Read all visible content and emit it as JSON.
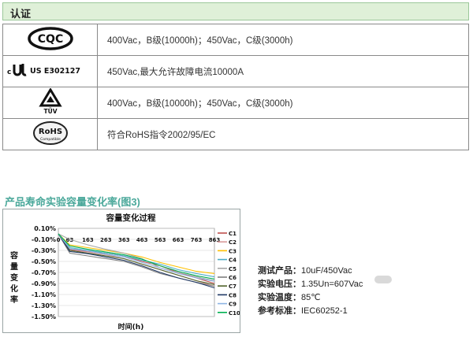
{
  "header": {
    "title": "认证"
  },
  "certifications": [
    {
      "logo": "CQC",
      "logo_icon": "cqc-logo-icon",
      "text": "400Vac，B级(10000h)；450Vac，C级(3000h)"
    },
    {
      "logo": "US E302127",
      "logo_prefix": "c",
      "logo_icon": "ul-logo-icon",
      "text": "450Vac,最大允许故障电流10000A"
    },
    {
      "logo": "TÜV",
      "logo_icon": "tuv-logo-icon",
      "text": "400Vac，B级(10000h)；450Vac，C级(3000h)"
    },
    {
      "logo": "RoHS",
      "logo_sub": "Compatible",
      "logo_icon": "rohs-logo-icon",
      "text": "符合RoHS指令2002/95/EC"
    }
  ],
  "section_title": "产品寿命实验容量变化率(图3)",
  "chart_data": {
    "type": "line",
    "title": "容量变化过程",
    "xlabel": "时间(h)",
    "ylabel": "容量变化率",
    "x": [
      0,
      63,
      163,
      263,
      363,
      463,
      563,
      663,
      763,
      863
    ],
    "x_ticks": [
      "0",
      "63",
      "163",
      "263",
      "363",
      "463",
      "563",
      "663",
      "763",
      "863"
    ],
    "y_ticks": [
      "0.10%",
      "-0.10%",
      "-0.30%",
      "-0.50%",
      "-0.70%",
      "-0.90%",
      "-1.10%",
      "-1.30%",
      "-1.50%"
    ],
    "ylim": [
      -1.5,
      0.1
    ],
    "grid": true,
    "legend": "right",
    "series": [
      {
        "name": "C1",
        "color": "#c0504d",
        "values": [
          0.0,
          -0.28,
          -0.32,
          -0.35,
          -0.4,
          -0.5,
          -0.58,
          -0.7,
          -0.8,
          -0.9
        ]
      },
      {
        "name": "C2",
        "color": "#d89a9a",
        "values": [
          0.0,
          -0.3,
          -0.33,
          -0.38,
          -0.45,
          -0.55,
          -0.65,
          -0.75,
          -0.85,
          -0.95
        ]
      },
      {
        "name": "C3",
        "color": "#ffc000",
        "values": [
          0.0,
          -0.2,
          -0.25,
          -0.3,
          -0.35,
          -0.42,
          -0.52,
          -0.6,
          -0.68,
          -0.72
        ]
      },
      {
        "name": "C4",
        "color": "#4bacc6",
        "values": [
          0.0,
          -0.25,
          -0.3,
          -0.35,
          -0.4,
          -0.48,
          -0.55,
          -0.65,
          -0.72,
          -0.78
        ]
      },
      {
        "name": "C5",
        "color": "#a6a6a6",
        "values": [
          0.0,
          -0.1,
          -0.2,
          -0.28,
          -0.35,
          -0.45,
          -0.62,
          -0.7,
          -0.78,
          -0.85
        ]
      },
      {
        "name": "C6",
        "color": "#7f7f7f",
        "values": [
          0.0,
          -0.35,
          -0.4,
          -0.45,
          -0.5,
          -0.6,
          -0.72,
          -0.8,
          -0.88,
          -0.95
        ]
      },
      {
        "name": "C7",
        "color": "#4f6228",
        "values": [
          0.0,
          -0.3,
          -0.35,
          -0.4,
          -0.45,
          -0.55,
          -0.65,
          -0.75,
          -0.85,
          -0.92
        ]
      },
      {
        "name": "C8",
        "color": "#1f3864",
        "values": [
          0.0,
          -0.32,
          -0.36,
          -0.42,
          -0.48,
          -0.58,
          -0.7,
          -0.8,
          -0.88,
          -0.98
        ]
      },
      {
        "name": "C9",
        "color": "#8eb4e3",
        "values": [
          0.0,
          -0.27,
          -0.31,
          -0.37,
          -0.42,
          -0.52,
          -0.62,
          -0.72,
          -0.8,
          -0.86
        ]
      },
      {
        "name": "C10",
        "color": "#00b050",
        "values": [
          0.0,
          -0.22,
          -0.28,
          -0.33,
          -0.38,
          -0.46,
          -0.58,
          -0.68,
          -0.76,
          -0.82
        ]
      }
    ]
  },
  "info": [
    {
      "label": "测试产品：",
      "value": "10uF/450Vac"
    },
    {
      "label": "实验电压：",
      "value": "1.35Un=607Vac"
    },
    {
      "label": "实验温度：",
      "value": "85℃"
    },
    {
      "label": "参考标准：",
      "value": "IEC60252-1"
    }
  ]
}
